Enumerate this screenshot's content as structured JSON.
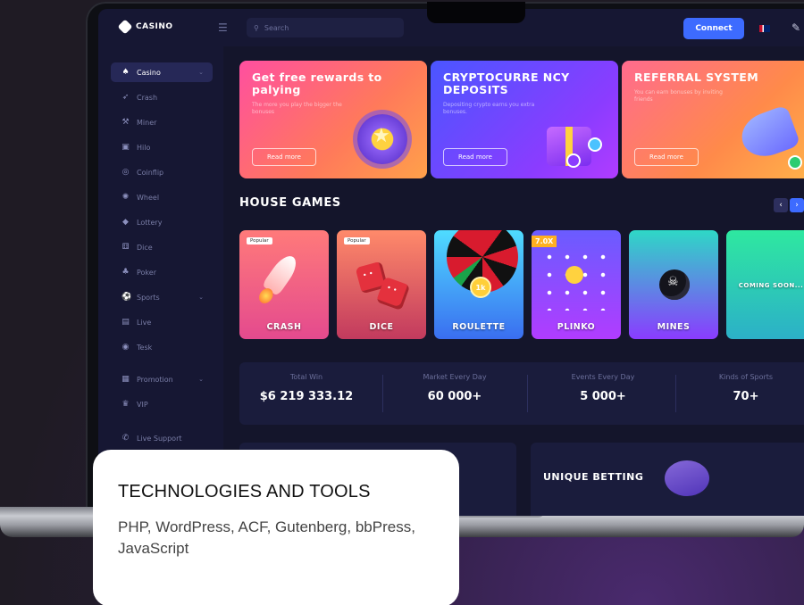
{
  "header": {
    "logo_text": "CASINO",
    "search_placeholder": "Search",
    "connect_label": "Connect"
  },
  "sidebar": {
    "items": [
      {
        "label": "Casino",
        "icon": "spade-icon"
      },
      {
        "label": "Crash",
        "icon": "rocket-icon"
      },
      {
        "label": "Miner",
        "icon": "pickaxe-icon"
      },
      {
        "label": "Hilo",
        "icon": "cards-icon"
      },
      {
        "label": "Coinflip",
        "icon": "coin-icon"
      },
      {
        "label": "Wheel",
        "icon": "wheel-icon"
      },
      {
        "label": "Lottery",
        "icon": "ticket-icon"
      },
      {
        "label": "Dice",
        "icon": "dice-icon"
      },
      {
        "label": "Poker",
        "icon": "club-icon"
      },
      {
        "label": "Sports",
        "icon": "ball-icon"
      },
      {
        "label": "Live",
        "icon": "live-icon"
      },
      {
        "label": "Tesk",
        "icon": "target-icon"
      },
      {
        "label": "Promotion",
        "icon": "gift-icon"
      },
      {
        "label": "VIP",
        "icon": "crown-icon"
      },
      {
        "label": "Live Support",
        "icon": "support-icon"
      }
    ]
  },
  "promos": [
    {
      "title": "Get free rewards to palying",
      "text": "The more you play the bigger the bonuses",
      "button": "Read more"
    },
    {
      "title": "CRYPTOCURRE NCY DEPOSITS",
      "text": "Depositing crypto earns you extra bonuses.",
      "button": "Read more"
    },
    {
      "title": "REFERRAL SYSTEM",
      "text": "You can earn bonuses by inviting friends",
      "button": "Read more"
    }
  ],
  "house_games": {
    "title": "HOUSE GAMES",
    "games": [
      {
        "label": "CRASH",
        "badge": "Popular"
      },
      {
        "label": "DICE",
        "badge": "Popular"
      },
      {
        "label": "ROULETTE",
        "badge": ""
      },
      {
        "label": "PLINKO",
        "badge": ""
      },
      {
        "label": "MINES",
        "badge": ""
      },
      {
        "label": "COMING SOON...",
        "badge": ""
      }
    ],
    "plinko_multiplier": "7.0X",
    "roulette_chip": "1k"
  },
  "stats": [
    {
      "title": "Total Win",
      "value": "$6 219 333.12"
    },
    {
      "title": "Market Every Day",
      "value": "60 000+"
    },
    {
      "title": "Events Every Day",
      "value": "5 000+"
    },
    {
      "title": "Kinds of Sports",
      "value": "70+"
    }
  ],
  "blocks": {
    "unique_betting": "UNIQUE BETTING"
  },
  "info_card": {
    "title": "TECHNOLOGIES AND TOOLS",
    "text": "PHP, WordPress, ACF, Gutenberg, bbPress, JavaScript"
  },
  "colors": {
    "accent": "#3d6bff",
    "sidebar_bg": "#161733",
    "screen_bg": "#14152b"
  }
}
